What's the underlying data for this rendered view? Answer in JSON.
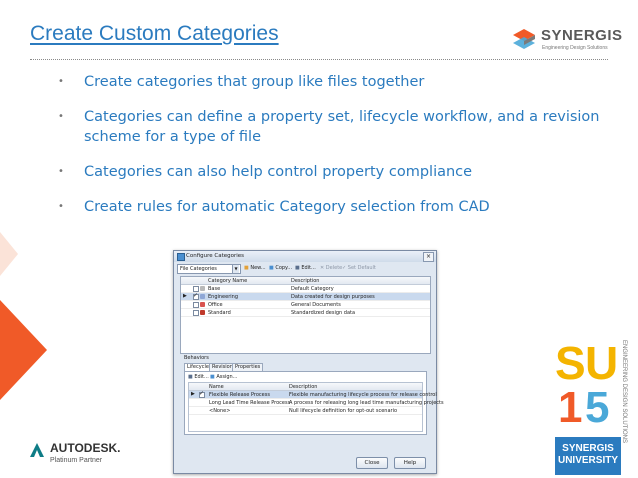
{
  "slide": {
    "title": "Create Custom Categories",
    "bullets": [
      "Create categories that group like files together",
      "Categories can define a property set, lifecycle workflow, and a revision scheme for a type of file",
      "Categories can also help control property compliance",
      "Create rules for automatic Category selection from CAD"
    ]
  },
  "brand": {
    "synergis": "SYNERGIS",
    "synergis_tagline": "Engineering Design Solutions",
    "autodesk": "AUTODESK.",
    "autodesk_sub": "Platinum Partner",
    "su_letters": [
      "S",
      "U",
      "1",
      "5"
    ],
    "su_vertical": "ENGINEERING DESIGN SOLUTIONS",
    "su_box_line1": "SYNERGIS",
    "su_box_line2": "UNIVERSITY"
  },
  "dialog": {
    "title": "Configure Categories",
    "close_glyph": "×",
    "filter_value": "File Categories",
    "toolbar": {
      "new": "New...",
      "copy": "Copy...",
      "edit": "Edit...",
      "delete": "Delete",
      "set_default": "Set Default"
    },
    "columns": {
      "name": "Category Name",
      "description": "Description"
    },
    "categories": [
      {
        "name": "Base",
        "description": "Default Category",
        "color": "#b9b9b9",
        "checked": false,
        "selected": false
      },
      {
        "name": "Engineering",
        "description": "Data created for design purposes",
        "color": "#8fa7d6",
        "checked": true,
        "selected": true
      },
      {
        "name": "Office",
        "description": "General Documents",
        "color": "#d9534f",
        "checked": false,
        "selected": false
      },
      {
        "name": "Standard",
        "description": "Standardized design data",
        "color": "#c0392b",
        "checked": false,
        "selected": false
      }
    ],
    "behaviors_label": "Behaviors",
    "tabs": [
      "Lifecycles",
      "Revisions",
      "Properties"
    ],
    "sub_toolbar": {
      "edit": "Edit...",
      "assign": "Assign..."
    },
    "lifecycle_columns": {
      "name": "Name",
      "description": "Description"
    },
    "lifecycles": [
      {
        "name": "Flexible Release Process",
        "description": "Flexible manufacturing lifecycle process for release control",
        "checked": true,
        "selected": true
      },
      {
        "name": "Long Lead Time Release Process",
        "description": "A process for releasing long lead time manufacturing projects",
        "checked": false,
        "selected": false
      },
      {
        "name": "<None>",
        "description": "Null lifecycle definition for opt-out scenario",
        "checked": false,
        "selected": false
      }
    ],
    "buttons": {
      "close": "Close",
      "help": "Help"
    }
  }
}
